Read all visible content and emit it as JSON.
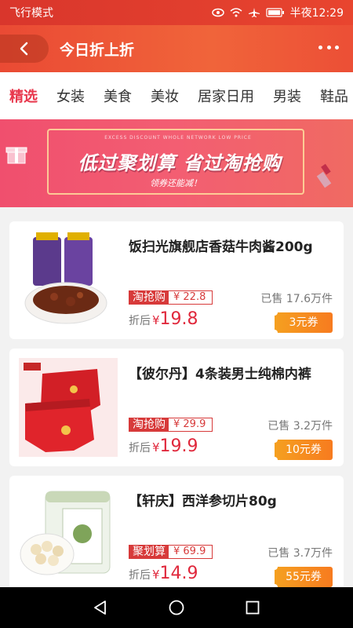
{
  "status": {
    "mode": "飞行模式",
    "time": "半夜12:29"
  },
  "header": {
    "title": "今日折上折"
  },
  "tabs": [
    "精选",
    "女装",
    "美食",
    "美妆",
    "居家日用",
    "男装",
    "鞋品"
  ],
  "banner": {
    "subtitle": "EXCESS DISCOUNT WHOLE NETWORK LOW PRICE",
    "headline": "低过聚划算 省过淘抢购",
    "tagline": "领券还能减！"
  },
  "products": [
    {
      "title": "饭扫光旗舰店香菇牛肉酱200g",
      "channel": "淘抢购",
      "channel_price": "¥ 22.8",
      "sold": "已售 17.6万件",
      "after_label": "折后",
      "currency": "¥",
      "after_price": "19.8",
      "coupon": "3元券"
    },
    {
      "title": "【彼尔丹】4条装男士纯棉内裤",
      "channel": "淘抢购",
      "channel_price": "¥ 29.9",
      "sold": "已售 3.2万件",
      "after_label": "折后",
      "currency": "¥",
      "after_price": "19.9",
      "coupon": "10元券"
    },
    {
      "title": "【轩庆】西洋参切片80g",
      "channel": "聚划算",
      "channel_price": "¥ 69.9",
      "sold": "已售 3.7万件",
      "after_label": "折后",
      "currency": "¥",
      "after_price": "14.9",
      "coupon": "55元券"
    }
  ],
  "colors": {
    "accent": "#e8374c",
    "header": "#ec4f36",
    "coupon": "#f78a20",
    "price": "#e0283c"
  }
}
